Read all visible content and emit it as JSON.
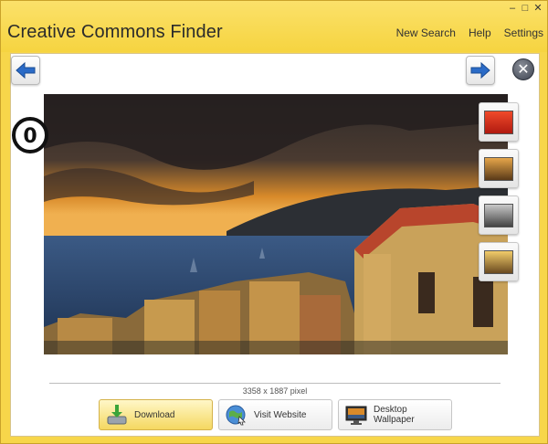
{
  "window": {
    "title": "Creative Commons Finder",
    "minimize_icon": "minimize-icon",
    "maximize_icon": "maximize-icon",
    "close_icon": "close-icon"
  },
  "menu": {
    "items": [
      "New Search",
      "Help",
      "Settings"
    ]
  },
  "toolbar": {
    "back_icon": "arrow-left-icon",
    "forward_icon": "arrow-right-icon",
    "close_icon": "close-circle-icon",
    "close_glyph": "✕"
  },
  "image": {
    "license_badge_icon": "cc0-license-icon",
    "license_badge_text": "0",
    "dimensions": "3358 x 1887 pixel"
  },
  "filters": {
    "items": [
      {
        "name": "filter-red-icon",
        "tone": "#d8331f"
      },
      {
        "name": "filter-sepia-icon",
        "tone": "#b6822f"
      },
      {
        "name": "filter-grayscale-icon",
        "tone": "#8a8a8a"
      },
      {
        "name": "filter-warm-icon",
        "tone": "#e2b24a"
      }
    ]
  },
  "actions": {
    "download_label": "Download",
    "visit_label": "Visit Website",
    "wallpaper_label": "Desktop Wallpaper",
    "download_icon": "download-icon",
    "visit_icon": "globe-icon",
    "wallpaper_icon": "desktop-wallpaper-icon"
  },
  "colors": {
    "title_bar": "#f7d64a",
    "accent_blue": "#2b6bc7",
    "primary_button": "#f5d860"
  }
}
